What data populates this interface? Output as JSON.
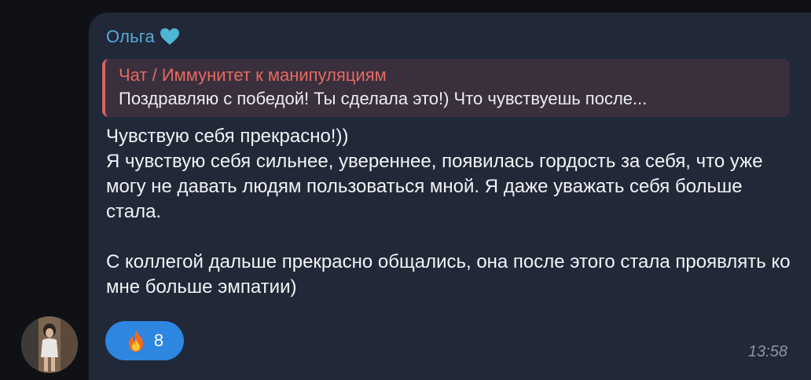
{
  "message": {
    "sender_name": "Ольга",
    "sender_badge": "heart-icon",
    "reply": {
      "title": "Чат / Иммунитет к манипуляциям",
      "text": "Поздравляю с победой!  Ты сделала это!) Что чувствуешь после..."
    },
    "body": "Чувствую себя прекрасно!))\nЯ чувствую себя сильнее, увереннее, появилась гордость за себя, что уже могу не давать людям пользоваться мной. Я даже уважать себя больше стала.\n\nС коллегой дальше прекрасно общались, она после этого стала проявлять ко мне больше эмпатии)",
    "reaction": {
      "icon": "fire-icon",
      "count": "8"
    },
    "time": "13:58"
  },
  "colors": {
    "background": "#0f1115",
    "bubble": "#212838",
    "sender_name": "#5aa9d8",
    "heart": "#4fb6d6",
    "reply_background": "#3a2f3d",
    "reply_accent": "#d9625c",
    "reply_title": "#e66a63",
    "reaction_background": "#2d86e0",
    "timestamp": "#8b93a4"
  }
}
